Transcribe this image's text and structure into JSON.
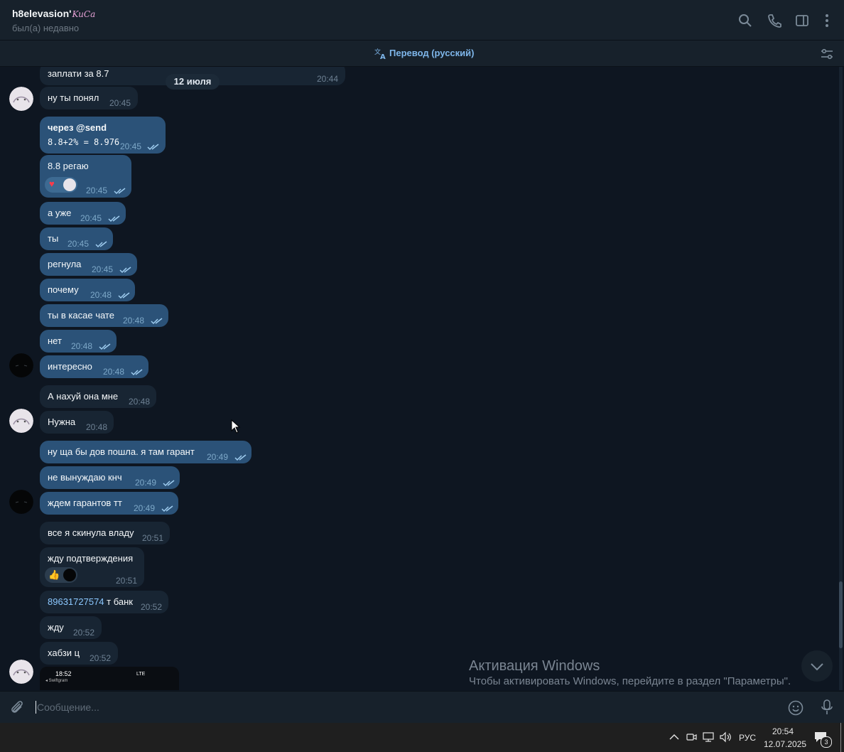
{
  "header": {
    "name": "h8elevasion'",
    "name_suffix": "KuCa",
    "status": "был(а) недавно",
    "icons": [
      "search-icon",
      "phone-icon",
      "sidebar-icon",
      "more-icon"
    ]
  },
  "translate_bar": {
    "label": "Перевод (русский)"
  },
  "date_pill": "12 июля",
  "messages": [
    {
      "text": "заплати за 8.7",
      "time": "20:44",
      "dir": "in"
    },
    {
      "text": "ну ты понял",
      "time": "20:45",
      "dir": "in"
    },
    {
      "text_line1": "через @send",
      "text_line2": "8.8+2% = 8.976",
      "time": "20:45",
      "dir": "out"
    },
    {
      "text": "8.8 регаю",
      "time": "20:45",
      "dir": "out",
      "reactions": [
        "heart"
      ]
    },
    {
      "text": "а уже",
      "time": "20:45",
      "dir": "out"
    },
    {
      "text": "ты",
      "time": "20:45",
      "dir": "out"
    },
    {
      "text": "регнула",
      "time": "20:45",
      "dir": "out"
    },
    {
      "text": "почему",
      "time": "20:48",
      "dir": "out"
    },
    {
      "text": "ты в касае чате",
      "time": "20:48",
      "dir": "out"
    },
    {
      "text": "нет",
      "time": "20:48",
      "dir": "out"
    },
    {
      "text": "интересно",
      "time": "20:48",
      "dir": "out"
    },
    {
      "text": "А нахуй она мне",
      "time": "20:48",
      "dir": "in"
    },
    {
      "text": "Нужна",
      "time": "20:48",
      "dir": "in"
    },
    {
      "text": "ну ща бы дов пошла. я там гарант",
      "time": "20:49",
      "dir": "out"
    },
    {
      "text": "не вынуждаю кнч",
      "time": "20:49",
      "dir": "out"
    },
    {
      "text": "ждем гарантов тт",
      "time": "20:49",
      "dir": "out"
    },
    {
      "text": "все я скинула владу",
      "time": "20:51",
      "dir": "in"
    },
    {
      "text": "жду подтверждения",
      "time": "20:51",
      "dir": "in",
      "reactions": [
        "thumbs-up"
      ]
    },
    {
      "text_link": "89631727574",
      "text": " т банк",
      "time": "20:52",
      "dir": "in"
    },
    {
      "text": "жду",
      "time": "20:52",
      "dir": "in"
    },
    {
      "text": "хабзи ц",
      "time": "20:52",
      "dir": "in"
    }
  ],
  "photo_preview": {
    "time": "18:52",
    "app": "◂ Swiftgram",
    "signal": "LTE"
  },
  "watermark": {
    "title": "Активация Windows",
    "subtitle": "Чтобы активировать Windows, перейдите в раздел \"Параметры\"."
  },
  "composer": {
    "placeholder": "Сообщение..."
  },
  "taskbar": {
    "lang": "РУС",
    "time": "20:54",
    "date": "12.07.2025",
    "notifications": "3"
  },
  "colors": {
    "incoming": "#182533",
    "outgoing": "#2b5278",
    "background": "#0e1621",
    "accent": "#7eb6ea"
  }
}
